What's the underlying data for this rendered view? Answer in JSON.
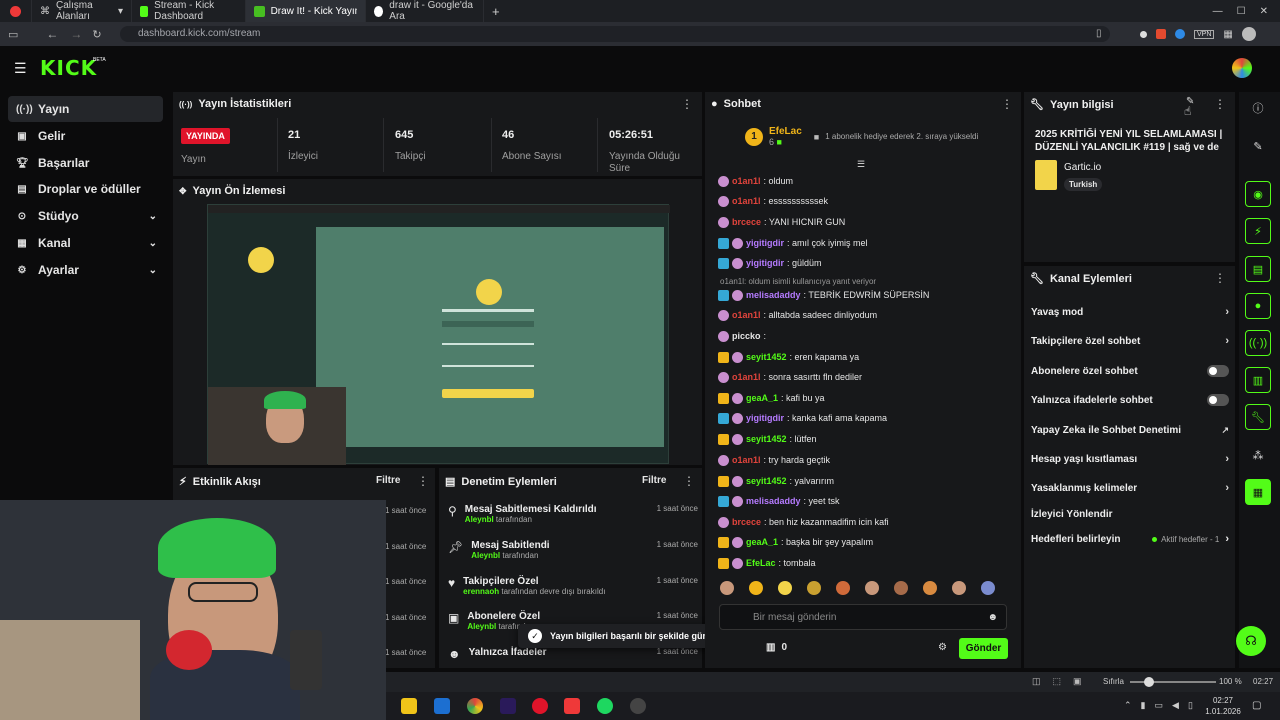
{
  "browser": {
    "tabs": [
      {
        "label": "Çalışma Alanları"
      },
      {
        "label": "Stream - Kick Dashboard"
      },
      {
        "label": "Draw It! - Kick Yayınları İçin"
      },
      {
        "label": "draw it - Google'da Ara"
      }
    ],
    "url": "dashboard.kick.com/stream",
    "vpn_label": "VPN"
  },
  "app": {
    "logo": "KICK",
    "beta": "BETA"
  },
  "sidebar": {
    "items": [
      {
        "label": "Yayın"
      },
      {
        "label": "Gelir"
      },
      {
        "label": "Başarılar"
      },
      {
        "label": "Droplar ve ödüller"
      },
      {
        "label": "Stüdyo"
      },
      {
        "label": "Kanal"
      },
      {
        "label": "Ayarlar"
      }
    ]
  },
  "stats": {
    "title": "Yayın İstatistikleri",
    "live_badge": "YAYINDA",
    "live_label": "Yayın",
    "items": [
      {
        "value": "21",
        "label": "İzleyici"
      },
      {
        "value": "645",
        "label": "Takipçi"
      },
      {
        "value": "46",
        "label": "Abone Sayısı"
      },
      {
        "value": "05:26:51",
        "label": "Yayında Olduğu Süre"
      }
    ]
  },
  "preview": {
    "title": "Yayın Ön İzlemesi"
  },
  "activity": {
    "title": "Etkinlik Akışı",
    "filter": "Filtre",
    "times": [
      "1 saat önce",
      "1 saat önce",
      "1 saat önce",
      "1 saat önce",
      "1 saat önce"
    ]
  },
  "moderation": {
    "title": "Denetim Eylemleri",
    "filter": "Filtre",
    "events": [
      {
        "title": "Mesaj Sabitlemesi Kaldırıldı",
        "user": "Aleynbl",
        "sub": " tarafından",
        "time": "1 saat önce"
      },
      {
        "title": "Mesaj Sabitlendi",
        "user": "Aleynbl",
        "sub": " tarafından",
        "time": "1 saat önce"
      },
      {
        "title": "Takipçilere Özel",
        "user": "erennaoh",
        "sub": " tarafından devre dışı bırakıldı",
        "time": "1 saat önce"
      },
      {
        "title": "Abonelere Özel",
        "user": "Aleynbl",
        "sub": " tarafından",
        "time": "1 saat önce"
      },
      {
        "title": "Yalnızca İfadeler",
        "user": "",
        "sub": "",
        "time": "1 saat önce"
      }
    ]
  },
  "toast": {
    "text": "Yayın bilgileri başarılı bir şekilde güncellendi."
  },
  "chat": {
    "title": "Sohbet",
    "pinned_user": "EfeLac",
    "pinned_count": "6",
    "pinned_text": "1 abonelik hediye ederek 2. sıraya yükseldi",
    "reply_hint": "o1an1l: oldum isimli kullanıcıya yanıt veriyor",
    "messages": [
      {
        "user": "o1an1l",
        "text": ": oldum",
        "color": "#e0443c"
      },
      {
        "user": "o1an1l",
        "text": ": essssssssssek",
        "color": "#e0443c"
      },
      {
        "user": "brcece",
        "text": ": YANI HICNIR GUN",
        "color": "#e0443c"
      },
      {
        "user": "yigitigdir",
        "text": ": amıl çok iyimiş mel",
        "color": "#b57bff"
      },
      {
        "user": "yigitigdir",
        "text": ": güldüm",
        "color": "#b57bff"
      },
      {
        "user": "melisadaddy",
        "text": ": TEBRİK EDWRİM SÜPERSİN",
        "color": "#b57bff"
      },
      {
        "user": "o1an1l",
        "text": ": alltabda sadeec dinliyodum",
        "color": "#e0443c"
      },
      {
        "user": "piccko",
        "text": ":",
        "color": "#e6e6e6"
      },
      {
        "user": "seyit1452",
        "text": ": eren kapama ya",
        "color": "#53fc18"
      },
      {
        "user": "o1an1l",
        "text": ": sonra sasırttı fln dediler",
        "color": "#e0443c"
      },
      {
        "user": "geaA_1",
        "text": ": kafi bu ya",
        "color": "#53fc18"
      },
      {
        "user": "yigitigdir",
        "text": ": kanka kafi ama kapama",
        "color": "#b57bff"
      },
      {
        "user": "seyit1452",
        "text": ": lütfen",
        "color": "#53fc18"
      },
      {
        "user": "o1an1l",
        "text": ": try harda geçtik",
        "color": "#e0443c"
      },
      {
        "user": "seyit1452",
        "text": ": yalvarırım",
        "color": "#53fc18"
      },
      {
        "user": "melisadaddy",
        "text": ": yeet tsk",
        "color": "#b57bff"
      },
      {
        "user": "brcece",
        "text": ": ben hiz kazanmadifim icin kafi",
        "color": "#e0443c"
      },
      {
        "user": "geaA_1",
        "text": ": başka bir şey yapalım",
        "color": "#53fc18"
      },
      {
        "user": "EfeLac",
        "text": ": tombala",
        "color": "#53fc18"
      }
    ],
    "input_placeholder": "Bir mesaj gönderin",
    "points": "0",
    "send_label": "Gönder"
  },
  "stream_info": {
    "title": "Yayın bilgisi",
    "stream_title": "2025 KRİTİĞİ YENİ YIL SELAMLAMASI | DÜZENLİ YALANCILIK #119 | sağ ve de sol",
    "category": "Gartic.io",
    "language": "Turkish"
  },
  "channel_actions": {
    "title": "Kanal Eylemleri",
    "items": [
      {
        "label": "Yavaş mod"
      },
      {
        "label": "Takipçilere özel sohbet"
      },
      {
        "label": "Abonelere özel sohbet"
      },
      {
        "label": "Yalnızca ifadelerle sohbet"
      },
      {
        "label": "Yapay Zeka ile Sohbet Denetimi"
      },
      {
        "label": "Hesap yaşı kısıtlaması"
      },
      {
        "label": "Yasaklanmış kelimeler"
      },
      {
        "label": "İzleyici Yönlendir"
      },
      {
        "label": "Hedefleri belirleyin"
      }
    ],
    "goals_status": "Aktif hedefler - 1"
  },
  "statusbar": {
    "reset": "Sıfırla",
    "zoom": "100 %",
    "time": "02:27"
  },
  "taskbar": {
    "time": "02:27",
    "date": "1.01.2026"
  },
  "colors": {
    "accent": "#53fc18",
    "live": "#e0142a",
    "panel": "#17181a"
  }
}
